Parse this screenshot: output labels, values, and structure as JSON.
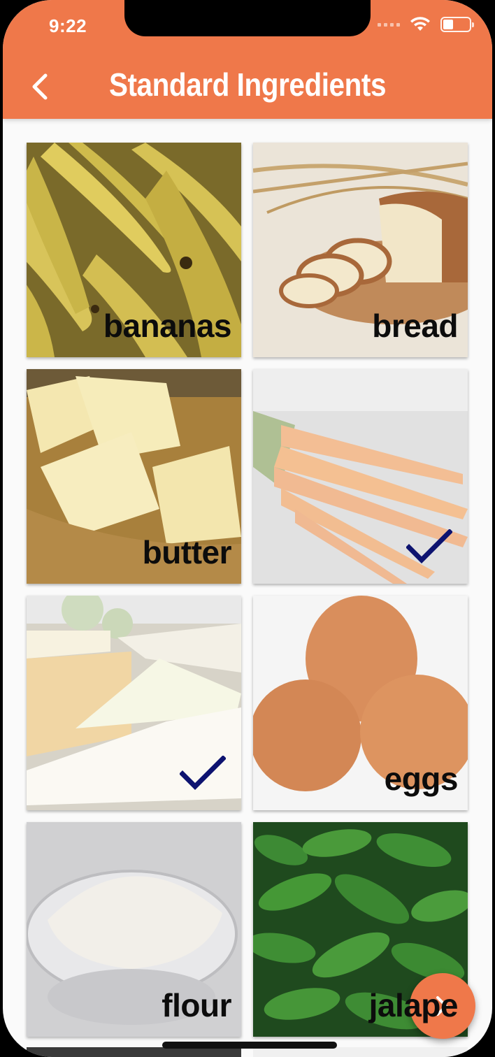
{
  "status_bar": {
    "time": "9:22"
  },
  "header": {
    "title": "Standard Ingredients",
    "back_icon": "chevron-left-icon"
  },
  "ingredients": [
    {
      "label": "bananas",
      "selected": false
    },
    {
      "label": "bread",
      "selected": false
    },
    {
      "label": "butter",
      "selected": false
    },
    {
      "label": "carrots",
      "selected": true,
      "label_visible": false
    },
    {
      "label": "cheese",
      "selected": true,
      "label_visible": false
    },
    {
      "label": "eggs",
      "selected": false
    },
    {
      "label": "flour",
      "selected": false
    },
    {
      "label": "jalapeños",
      "selected": false,
      "visible_text": "jalape"
    }
  ],
  "fab": {
    "icon": "chevron-right-icon"
  },
  "colors": {
    "accent": "#ef784a",
    "check": "#0d1370"
  }
}
